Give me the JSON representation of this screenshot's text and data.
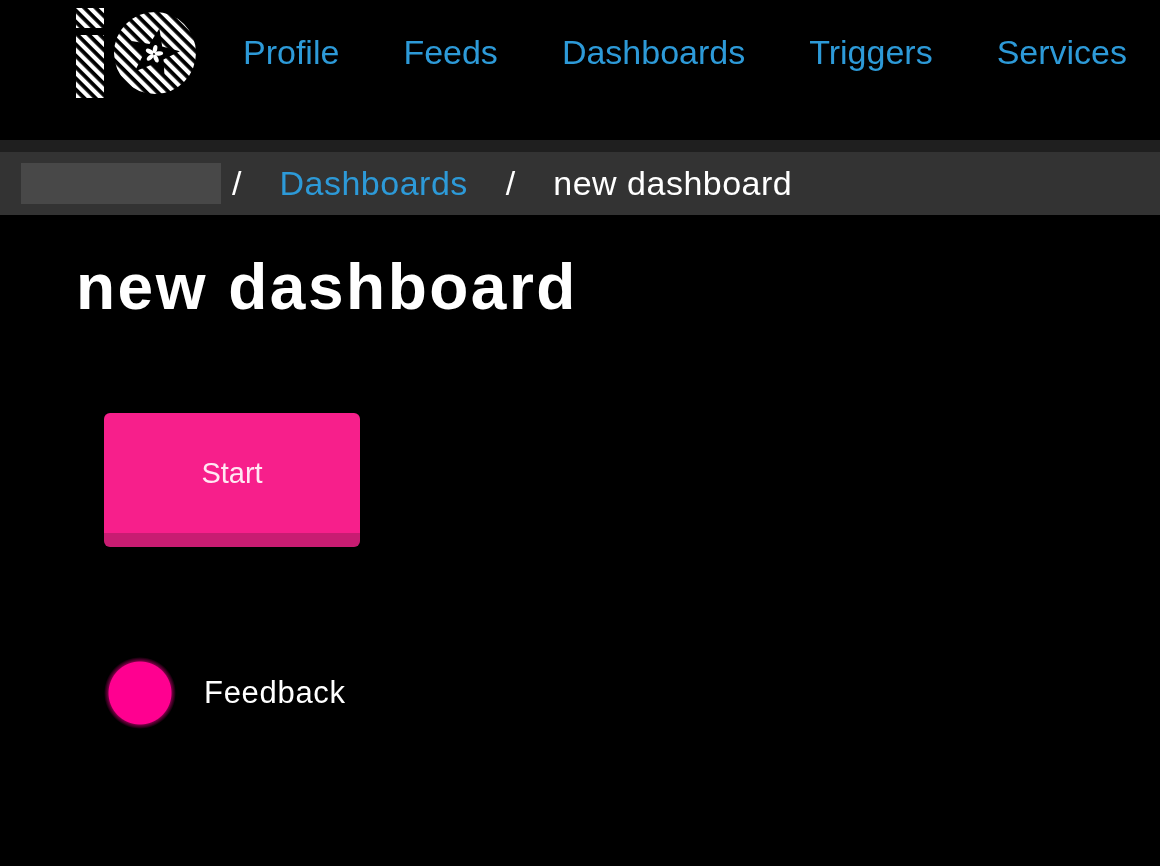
{
  "header": {
    "nav": [
      "Profile",
      "Feeds",
      "Dashboards",
      "Triggers",
      "Services"
    ]
  },
  "breadcrumb": [
    {
      "kind": "redacted"
    },
    {
      "kind": "separator",
      "text": "/"
    },
    {
      "kind": "link",
      "text": "Dashboards"
    },
    {
      "kind": "separator",
      "text": "/"
    },
    {
      "kind": "current",
      "text": "new dashboard"
    }
  ],
  "title": "new dashboard",
  "blocks": [
    {
      "kind": "button",
      "label": "Start"
    },
    {
      "kind": "indicator",
      "label": "Feedback",
      "on": true
    }
  ]
}
